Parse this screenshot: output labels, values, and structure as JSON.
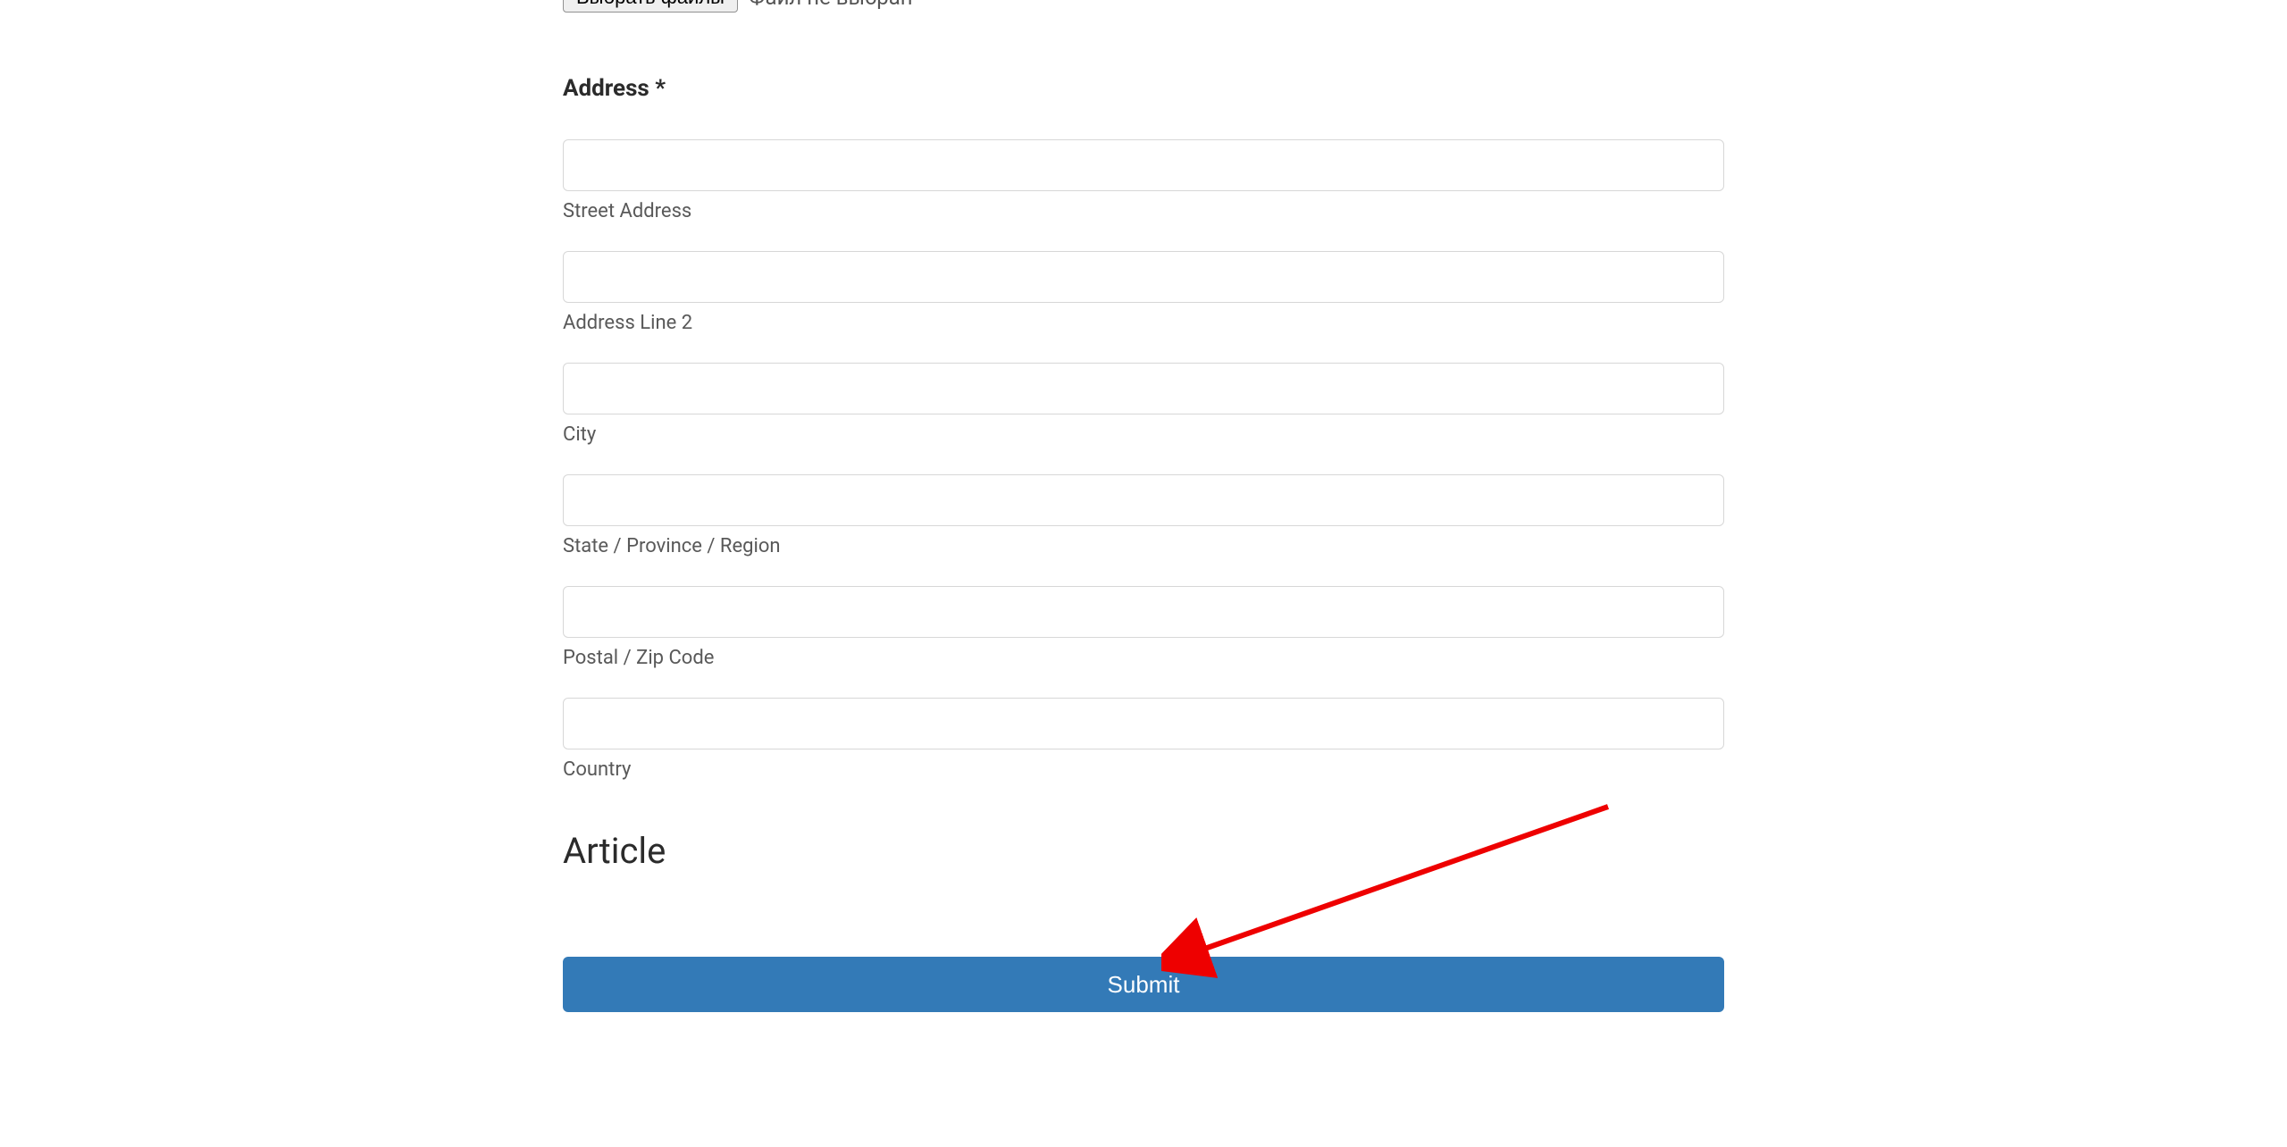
{
  "fileUpload": {
    "buttonLabel": "Выбрать файлы",
    "statusText": "Файл не выбран"
  },
  "address": {
    "sectionLabel": "Address *",
    "fields": {
      "street": {
        "label": "Street Address",
        "value": ""
      },
      "line2": {
        "label": "Address Line 2",
        "value": ""
      },
      "city": {
        "label": "City",
        "value": ""
      },
      "state": {
        "label": "State / Province / Region",
        "value": ""
      },
      "postal": {
        "label": "Postal / Zip Code",
        "value": ""
      },
      "country": {
        "label": "Country",
        "value": ""
      }
    }
  },
  "article": {
    "heading": "Article"
  },
  "submit": {
    "label": "Submit"
  },
  "annotation": {
    "arrowColor": "#ee0000"
  }
}
